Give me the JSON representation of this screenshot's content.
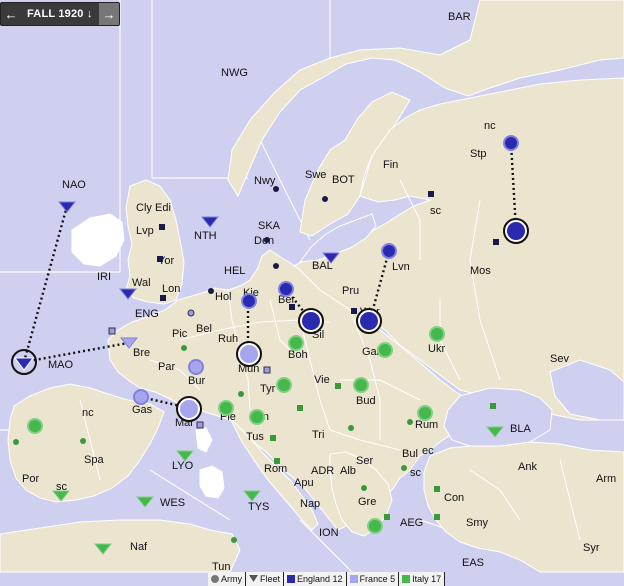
{
  "nav": {
    "prev_icon": "←",
    "phase": "FALL 1920 ↓",
    "next_icon": "→"
  },
  "legend": {
    "army": "Army",
    "fleet": "Fleet",
    "england": "England 12",
    "france": "France 5",
    "italy": "Italy 17"
  },
  "colors": {
    "england": "#2a2ab0",
    "france": "#a6a6ee",
    "italy": "#44b84a",
    "sea": "#cfcff0",
    "land": "#ebe5cf"
  },
  "map": {
    "sea_labels": [
      "BAR",
      "NWG",
      "NAO",
      "NTH",
      "SKA",
      "HEL",
      "BAL",
      "BOT",
      "IRI",
      "ENG",
      "MAO",
      "LYO",
      "WES",
      "TYS",
      "ADR",
      "ION",
      "AEG",
      "EAS",
      "BLA"
    ],
    "land_labels": [
      "Nwy",
      "Swe",
      "Fin",
      "Stp",
      "nc",
      "sc",
      "Mos",
      "Lvn",
      "Pru",
      "Den",
      "Kie",
      "Ber",
      "Hol",
      "Bel",
      "Ruh",
      "Pic",
      "Bre",
      "Par",
      "Bur",
      "Mun",
      "Boh",
      "Sil",
      "War",
      "Gal",
      "Ukr",
      "Sev",
      "Cly",
      "Edi",
      "Lvp",
      "Yor",
      "Wal",
      "Lon",
      "Gas",
      "Mar",
      "Pie",
      "Ven",
      "Tus",
      "Rom",
      "Apu",
      "Nap",
      "Tyr",
      "Vie",
      "Bud",
      "Tri",
      "Ser",
      "Alb",
      "Gre",
      "Rum",
      "Bul",
      "ec",
      "Con",
      "Smy",
      "Ank",
      "Arm",
      "Syr",
      "Spa",
      "Por",
      "Naf",
      "Tun",
      "nc",
      "sc"
    ]
  }
}
